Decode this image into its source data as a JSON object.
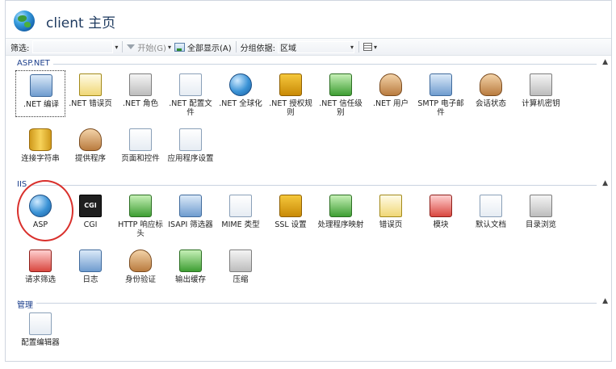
{
  "header": {
    "title": "client 主页"
  },
  "toolbar": {
    "filter_label": "筛选:",
    "start_label": "开始(G)",
    "show_all_label": "全部显示(A)",
    "group_by_label": "分组依据:",
    "group_by_value": "区域"
  },
  "sections": [
    {
      "title": "ASP.NET",
      "items": [
        {
          "label": ".NET 编译",
          "icon": "compile-icon"
        },
        {
          "label": ".NET 错误页",
          "icon": "error-page-icon"
        },
        {
          "label": ".NET 角色",
          "icon": "roles-icon"
        },
        {
          "label": ".NET 配置文件",
          "icon": "profile-icon"
        },
        {
          "label": ".NET 全球化",
          "icon": "globalization-icon"
        },
        {
          "label": ".NET 授权规则",
          "icon": "authorization-icon"
        },
        {
          "label": ".NET 信任级别",
          "icon": "trust-level-icon"
        },
        {
          "label": ".NET 用户",
          "icon": "users-icon"
        },
        {
          "label": "SMTP 电子邮件",
          "icon": "smtp-icon"
        },
        {
          "label": "会话状态",
          "icon": "session-state-icon"
        },
        {
          "label": "计算机密钥",
          "icon": "machine-key-icon"
        },
        {
          "label": "连接字符串",
          "icon": "connection-string-icon"
        },
        {
          "label": "提供程序",
          "icon": "providers-icon"
        },
        {
          "label": "页面和控件",
          "icon": "pages-controls-icon"
        },
        {
          "label": "应用程序设置",
          "icon": "app-settings-icon"
        }
      ]
    },
    {
      "title": "IIS",
      "items": [
        {
          "label": "ASP",
          "icon": "asp-icon"
        },
        {
          "label": "CGI",
          "icon": "cgi-icon",
          "glyph": "CGI"
        },
        {
          "label": "HTTP 响应标头",
          "icon": "http-headers-icon"
        },
        {
          "label": "ISAPI 筛选器",
          "icon": "isapi-filter-icon"
        },
        {
          "label": "MIME 类型",
          "icon": "mime-icon"
        },
        {
          "label": "SSL 设置",
          "icon": "ssl-lock-icon"
        },
        {
          "label": "处理程序映射",
          "icon": "handler-mapping-icon"
        },
        {
          "label": "错误页",
          "icon": "error-pages-icon"
        },
        {
          "label": "模块",
          "icon": "modules-icon"
        },
        {
          "label": "默认文档",
          "icon": "default-document-icon"
        },
        {
          "label": "目录浏览",
          "icon": "directory-browsing-icon"
        },
        {
          "label": "请求筛选",
          "icon": "request-filtering-icon"
        },
        {
          "label": "日志",
          "icon": "logging-icon"
        },
        {
          "label": "身份验证",
          "icon": "authentication-icon"
        },
        {
          "label": "输出缓存",
          "icon": "output-cache-icon"
        },
        {
          "label": "压缩",
          "icon": "compression-icon"
        }
      ]
    },
    {
      "title": "管理",
      "items": [
        {
          "label": "配置编辑器",
          "icon": "config-editor-icon"
        }
      ]
    }
  ],
  "colors": {
    "section_title": "#1c3f8c",
    "highlight_ring": "#d9302c"
  }
}
